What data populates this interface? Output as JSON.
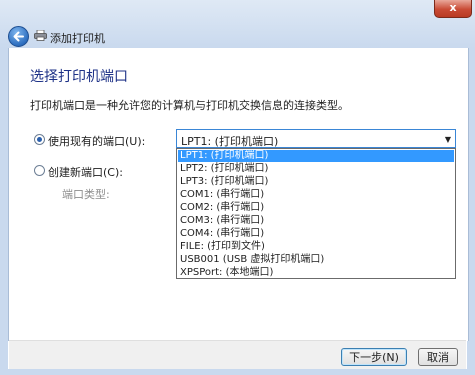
{
  "window": {
    "title": "添加打印机",
    "close_label": "x"
  },
  "page": {
    "heading": "选择打印机端口",
    "description": "打印机端口是一种允许您的计算机与打印机交换信息的连接类型。"
  },
  "options": {
    "use_existing_label": "使用现有的端口(U):",
    "create_new_label": "创建新端口(C):",
    "port_type_label": "端口类型:"
  },
  "port_select": {
    "selected": "LPT1: (打印机端口)",
    "items": [
      "LPT1: (打印机端口)",
      "LPT2: (打印机端口)",
      "LPT3: (打印机端口)",
      "COM1: (串行端口)",
      "COM2: (串行端口)",
      "COM3: (串行端口)",
      "COM4: (串行端口)",
      "FILE: (打印到文件)",
      "USB001 (USB 虚拟打印机端口)",
      "XPSPort: (本地端口)"
    ]
  },
  "buttons": {
    "next": "下一步(N)",
    "cancel": "取消"
  },
  "icons": {
    "back": "back-arrow-icon",
    "printer": "printer-icon",
    "dropdown": "chevron-down-icon"
  },
  "colors": {
    "heading": "#1e3287",
    "selection": "#3399ff",
    "chrome": "#c9d9ee"
  }
}
